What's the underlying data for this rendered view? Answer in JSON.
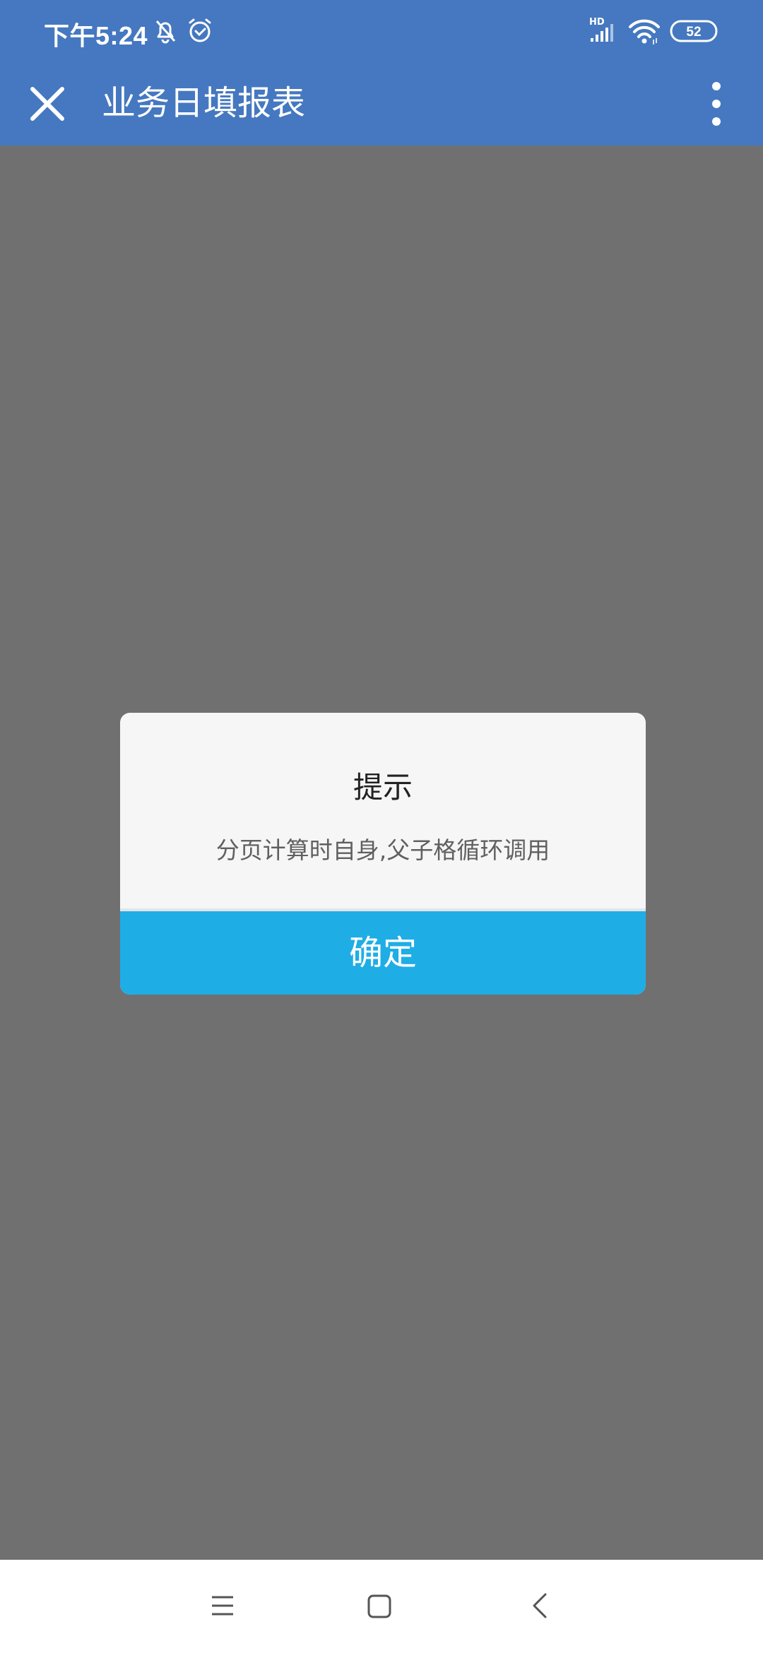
{
  "status_bar": {
    "time": "下午5:24",
    "icons": [
      "bell-muted-icon",
      "alarm-icon",
      "hd-signal-icon",
      "wifi-icon",
      "battery-icon"
    ],
    "network_label": "HD",
    "battery_level": "52"
  },
  "app_bar": {
    "title": "业务日填报表",
    "close_icon": "close-icon",
    "more_icon": "more-vertical-icon"
  },
  "dialog": {
    "title": "提示",
    "message": "分页计算时自身,父子格循环调用",
    "ok_label": "确定"
  },
  "nav_bar": {
    "icons": [
      "menu-icon",
      "home-icon",
      "back-icon"
    ]
  },
  "colors": {
    "header": "#4578c0",
    "overlay": "#707070",
    "dialog_bg": "#f6f6f6",
    "button": "#1fade6"
  }
}
